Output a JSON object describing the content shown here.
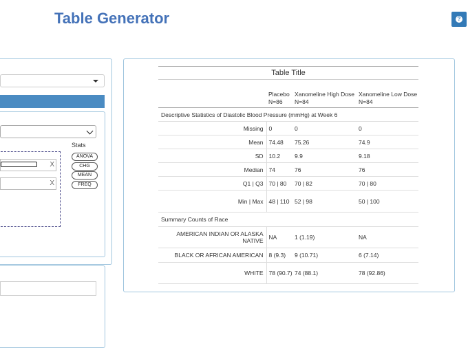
{
  "app": {
    "title": "Table Generator",
    "help_icon": "?"
  },
  "left_panel": {
    "stats": {
      "label": "Stats",
      "buttons": [
        "ANOVA",
        "CHG",
        "MEAN",
        "FREQ"
      ],
      "remove_label": "X"
    }
  },
  "table": {
    "title": "Table Title",
    "columns": [
      {
        "name": "Placebo",
        "n": "N=86"
      },
      {
        "name": "Xanomeline High Dose",
        "n": "N=84"
      },
      {
        "name": "Xanomeline Low Dose",
        "n": "N=84"
      }
    ],
    "section1": {
      "title": "Descriptive Statistics of Diastolic Blood Pressure (mmHg) at Week 6",
      "rows": [
        {
          "label": "Missing",
          "values": [
            "0",
            "0",
            "0"
          ]
        },
        {
          "label": "Mean",
          "values": [
            "74.48",
            "75.26",
            "74.9"
          ]
        },
        {
          "label": "SD",
          "values": [
            "10.2",
            "9.9",
            "9.18"
          ]
        },
        {
          "label": "Median",
          "values": [
            "74",
            "76",
            "76"
          ]
        },
        {
          "label": "Q1 | Q3",
          "values": [
            "70 | 80",
            "70 | 82",
            "70 | 80"
          ]
        },
        {
          "label": "Min | Max",
          "values": [
            "48 | 110",
            "52 | 98",
            "50 | 100"
          ]
        }
      ]
    },
    "section2": {
      "title": "Summary Counts of Race",
      "rows": [
        {
          "label": "AMERICAN INDIAN OR ALASKA NATIVE",
          "values": [
            "NA",
            "1 (1.19)",
            "NA"
          ]
        },
        {
          "label": "BLACK OR AFRICAN AMERICAN",
          "values": [
            "8 (9.3)",
            "9 (10.71)",
            "6 (7.14)"
          ]
        },
        {
          "label": "WHITE",
          "values": [
            "78 (90.7)",
            "74 (88.1)",
            "78 (92.86)"
          ]
        }
      ]
    }
  }
}
